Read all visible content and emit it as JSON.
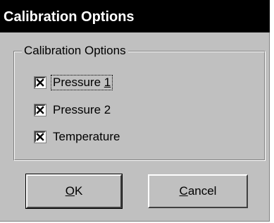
{
  "dialog": {
    "title": "Calibration Options"
  },
  "group": {
    "label": "Calibration Options"
  },
  "options": [
    {
      "label_pre": "Pressure ",
      "label_mnemonic": "1",
      "label_post": "",
      "checked": true
    },
    {
      "label_pre": "Pressure 2",
      "label_mnemonic": "",
      "label_post": "",
      "checked": true
    },
    {
      "label_pre": "Temperature",
      "label_mnemonic": "",
      "label_post": "",
      "checked": true
    }
  ],
  "buttons": {
    "ok": {
      "mnemonic": "O",
      "rest": "K"
    },
    "cancel": {
      "mnemonic": "C",
      "rest": "ancel"
    }
  },
  "colors": {
    "face": "#c0c0c0",
    "titlebar": "#000000",
    "title_text": "#ffffff"
  }
}
